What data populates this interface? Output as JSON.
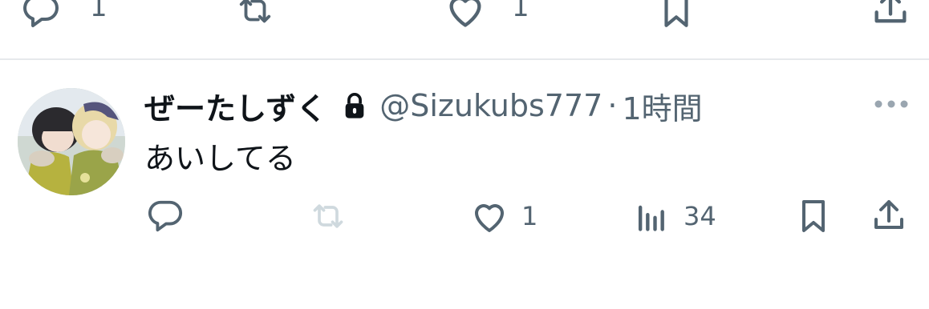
{
  "prev_tweet": {
    "reply_count": "1",
    "like_count": "1"
  },
  "tweet": {
    "display_name": "ぜーたしずく",
    "handle": "@Sizukubs777",
    "separator": "·",
    "time": "1時間",
    "text": "あいしてる",
    "actions": {
      "like_count": "1",
      "view_count": "34"
    }
  },
  "colors": {
    "icon_gray": "#536471",
    "retweet_disabled": "#cfd9de",
    "name": "#0f1419",
    "divider": "#e6e9ec"
  }
}
